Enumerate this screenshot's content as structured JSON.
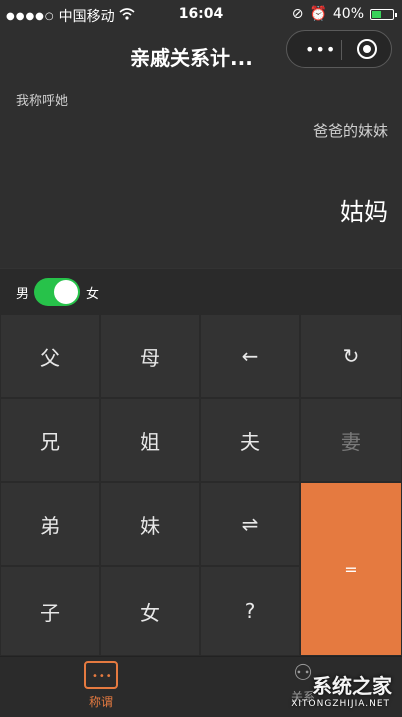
{
  "status_bar": {
    "carrier": "中国移动",
    "time": "16:04",
    "battery": "40%"
  },
  "header": {
    "title": "亲戚关系计..."
  },
  "capsule": {
    "more_icon": "more-dots-icon",
    "close_icon": "target-circle-icon"
  },
  "display": {
    "label": "我称呼她",
    "input": "爸爸的妹妹",
    "result": "姑妈"
  },
  "gender": {
    "male": "男",
    "female": "女",
    "selected": "女"
  },
  "keypad": {
    "r1": [
      "父",
      "母",
      "←",
      "↻"
    ],
    "r2": [
      "兄",
      "姐",
      "夫",
      "妻"
    ],
    "r3": [
      "弟",
      "妹",
      "⇌"
    ],
    "r4": [
      "子",
      "女",
      "?"
    ],
    "equals": "="
  },
  "tabs": [
    {
      "label": "称谓",
      "icon": "chat-icon",
      "active": true
    },
    {
      "label": "关系",
      "icon": "relation-icon",
      "active": false
    }
  ],
  "colors": {
    "accent": "#e57a40",
    "toggle": "#27c24a",
    "battery": "#39d25a"
  },
  "watermark": {
    "text": "系统之家",
    "url": "XITONGZHIJIA.NET"
  }
}
